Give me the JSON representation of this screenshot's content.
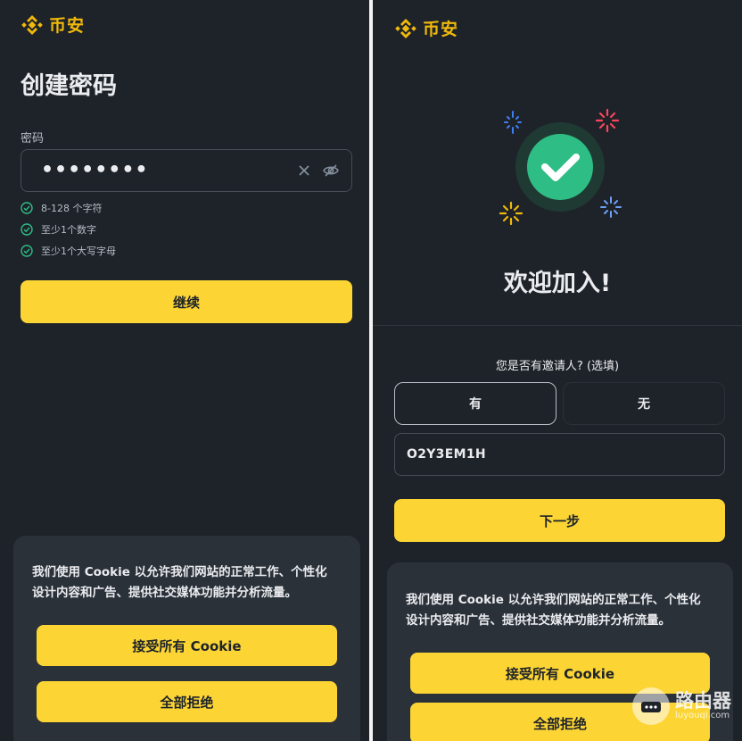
{
  "colors": {
    "brand": "#f0b90b",
    "button": "#fcd535",
    "bg": "#1e2329",
    "check": "#2ebd85"
  },
  "brand": {
    "name": "币安"
  },
  "left": {
    "title": "创建密码",
    "password_label": "密码",
    "password_value": "••••••••",
    "rules": [
      "8-128 个字符",
      "至少1个数字",
      "至少1个大写字母"
    ],
    "continue_label": "继续"
  },
  "right": {
    "welcome": "欢迎加入!",
    "referral_question": "您是否有邀请人? (选填)",
    "option_yes": "有",
    "option_no": "无",
    "referral_code": "O2Y3EM1H",
    "next_label": "下一步"
  },
  "cookie": {
    "text_line1": "我们使用 Cookie 以允许我们网站的正常工作、个性化",
    "text_line2": "设计内容和广告、提供社交媒体功能并分析流量。",
    "accept_label": "接受所有 Cookie",
    "reject_label": "全部拒绝"
  },
  "watermark": {
    "title": "路由器",
    "domain": "luyouqi.com"
  }
}
